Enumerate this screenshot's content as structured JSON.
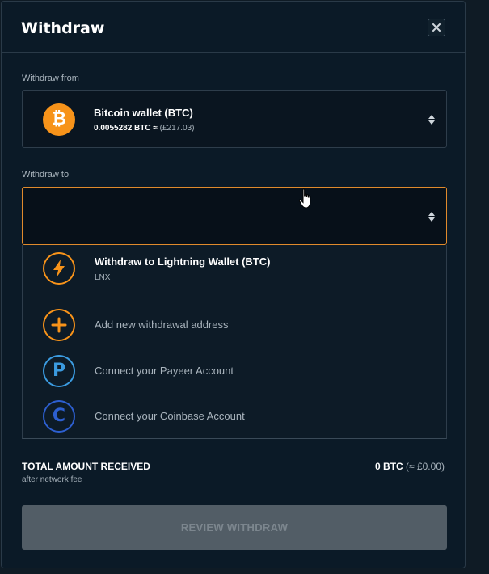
{
  "header": {
    "title": "Withdraw",
    "close_icon": "close-icon"
  },
  "withdraw_from": {
    "label": "Withdraw from",
    "wallet_name": "Bitcoin wallet (BTC)",
    "balance_btc": "0.0055282 BTC ≈",
    "balance_fiat": "(£217.03)",
    "icon": "bitcoin-icon",
    "icon_glyph": "₿",
    "accent_color": "#f7931a"
  },
  "withdraw_to": {
    "label": "Withdraw to",
    "value": "",
    "border_color": "#e08a2c",
    "options": [
      {
        "label": "Withdraw to Lightning Wallet (BTC)",
        "sublabel": "LNX",
        "icon": "lightning-icon"
      },
      {
        "label": "Add new withdrawal address",
        "icon": "plus-icon"
      },
      {
        "label": "Connect your Payeer Account",
        "icon": "payeer-icon",
        "icon_glyph": "P",
        "color": "#3b9be0"
      },
      {
        "label": "Connect your Coinbase Account",
        "icon": "coinbase-icon",
        "icon_glyph": "C",
        "color": "#2d5fd0"
      }
    ]
  },
  "total": {
    "label": "TOTAL AMOUNT RECEIVED",
    "sublabel": "after network fee",
    "value_btc": "0 BTC",
    "value_fiat": "(≈ £0.00)"
  },
  "review_button": {
    "label": "REVIEW WITHDRAW",
    "disabled": true
  }
}
